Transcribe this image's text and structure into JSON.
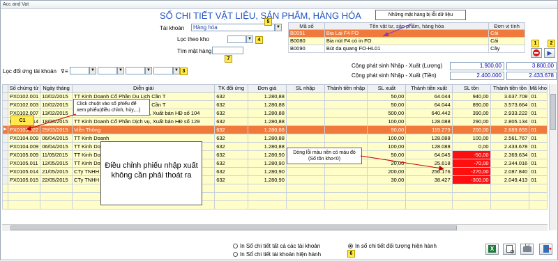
{
  "window": {
    "title": "Acc and Vat"
  },
  "heading": "SỔ CHI TIẾT VẬT LIỆU, SẢN PHẨM, HÀNG HÓA",
  "filters": {
    "account_label": "Tài khoản",
    "account_value": "Hàng hóa",
    "stock_filter_label": "Lọc theo kho",
    "item_search_label": "Tìm mặt hàng",
    "contra_filter_label": "Lọc đối ứng tài khoản",
    "contra_filter_ops": "⊽≡"
  },
  "badges": [
    "1",
    "2",
    "3",
    "4",
    "5",
    "6",
    "7"
  ],
  "callouts": {
    "error_items": "Những mặt hàng bị lỗi dữ liệu",
    "click_voucher": "Click chuột vào số phiếu để xem phiếu(điều chỉnh, hủy,...)",
    "c1": "C1",
    "red_row": "Dòng lỗi màu nền có màu đỏ (Số tồn kho<0)",
    "edit_voucher": "Điều chỉnh phiếu nhập xuất không cần phải thoát ra"
  },
  "item_grid": {
    "columns": [
      "Mã số",
      "Tên vật tư, sản phẩm, hàng hóa",
      "Đơn vị tính"
    ],
    "rows": [
      {
        "code": "B0051",
        "name": "Bia Lái F4 FO",
        "unit": "Cái",
        "state": "selected"
      },
      {
        "code": "B0080",
        "name": "Bia nút F4 có in FO",
        "unit": "Cái",
        "state": "highlight"
      },
      {
        "code": "B0090",
        "name": "Bút da quang FO-HL01",
        "unit": "Cây",
        "state": "normal"
      }
    ]
  },
  "totals": {
    "qty_label": "Cộng phát sinh Nhập - Xuất (Lượng)",
    "qty_in": "1.900,00",
    "qty_out": "3.800,00",
    "amount_label": "Cộng phát sinh Nhập - Xuất (Tiền)",
    "amount_in": "2.400.000",
    "amount_out": "2.433.678"
  },
  "ledger": {
    "columns": [
      "Số chứng từ",
      "Ngày tháng",
      "Diễn giải",
      "TK đối ứng",
      "Đơn giá",
      "SL nhập",
      "Thành tiền nhập",
      "SL xuất",
      "Thành tiền xuất",
      "SL tồn",
      "Thành tiền tồn",
      "Mã kho"
    ],
    "rows": [
      {
        "doc": "PX0102.001",
        "date": "10/02/2015",
        "desc": "TT Kinh Doanh Cổ Phần Du Lịch Cần T",
        "acct": "632",
        "price": "1.280,88",
        "qin": "",
        "ain": "",
        "qout": "50,00",
        "aout": "64.044",
        "qbal": "940,00",
        "abal": "3.637.708",
        "wh": "01",
        "state": "normal"
      },
      {
        "doc": "PX0102.003",
        "date": "10/02/2015",
        "desc": "TT Kinh Doanh Cổ Phần Du Lịch Cần T",
        "acct": "632",
        "price": "1.280,88",
        "qin": "",
        "ain": "",
        "qout": "50,00",
        "aout": "64.044",
        "qbal": "890,00",
        "abal": "3.573.664",
        "wh": "01",
        "state": "normal"
      },
      {
        "doc": "PX0102.007",
        "date": "13/02/2015",
        "desc": "TT Kinh Doanh Cổ Phần Dịch vụ, Xuất bán HĐ số 104",
        "acct": "632",
        "price": "1.280,88",
        "qin": "",
        "ain": "",
        "qout": "500,00",
        "aout": "640.442",
        "qbal": "390,00",
        "abal": "2.933.222",
        "wh": "01",
        "state": "normal"
      },
      {
        "doc": "PX0103.014",
        "date": "18/03/2015",
        "desc": "TT Kinh Doanh Cổ Phần Dịch vụ, Xuất bán HĐ số 129",
        "acct": "632",
        "price": "1.280,88",
        "qin": "",
        "ain": "",
        "qout": "100,00",
        "aout": "128.088",
        "qbal": "290,00",
        "abal": "2.805.134",
        "wh": "01",
        "state": "normal"
      },
      {
        "doc": "PX0103.022",
        "date": "29/03/2015",
        "desc": "Viễn Thông",
        "acct": "632",
        "price": "1.280,88",
        "qin": "",
        "ain": "",
        "qout": "90,00",
        "aout": "115.279",
        "qbal": "200,00",
        "abal": "2.689.855",
        "wh": "01",
        "state": "current"
      },
      {
        "doc": "PX0104.009",
        "date": "06/04/2015",
        "desc": "TT Kinh Doanh",
        "acct": "632",
        "price": "1.280,88",
        "qin": "",
        "ain": "",
        "qout": "100,00",
        "aout": "128.088",
        "qbal": "100,00",
        "abal": "2.561.767",
        "wh": "01",
        "state": "normal"
      },
      {
        "doc": "PX0104.009",
        "date": "06/04/2015",
        "desc": "TT Kinh Doanh",
        "acct": "632",
        "price": "1.280,88",
        "qin": "",
        "ain": "",
        "qout": "100,00",
        "aout": "128.088",
        "qbal": "0,00",
        "abal": "2.433.678",
        "wh": "01",
        "state": "normal"
      },
      {
        "doc": "PX0105.009",
        "date": "11/05/2015",
        "desc": "TT Kinh Doanh",
        "acct": "632",
        "price": "1.280,90",
        "qin": "",
        "ain": "",
        "qout": "50,00",
        "aout": "64.045",
        "qbal": "-50,00",
        "abal": "2.369.634",
        "wh": "01",
        "state": "negative"
      },
      {
        "doc": "PX0105.011",
        "date": "12/05/2015",
        "desc": "TT Kinh Doanh",
        "acct": "632",
        "price": "1.280,90",
        "qin": "",
        "ain": "",
        "qout": "20,00",
        "aout": "25.618",
        "qbal": "-70,00",
        "abal": "2.344.016",
        "wh": "01",
        "state": "negative"
      },
      {
        "doc": "PX0105.014",
        "date": "21/05/2015",
        "desc": "CTy TNHH Thương Mại Dịch Vụ H Vụ H",
        "acct": "632",
        "price": "1.280,90",
        "qin": "",
        "ain": "",
        "qout": "200,00",
        "aout": "256.176",
        "qbal": "-270,00",
        "abal": "2.087.840",
        "wh": "01",
        "state": "negative"
      },
      {
        "doc": "PX0105.015",
        "date": "22/05/2015",
        "desc": "CTy TNHH",
        "acct": "632",
        "price": "1.280,90",
        "qin": "",
        "ain": "",
        "qout": "30,00",
        "aout": "38.427",
        "qbal": "-300,00",
        "abal": "2.049.413",
        "wh": "01",
        "state": "negative"
      }
    ]
  },
  "options": {
    "all_accounts": "In Sổ chi tiết tất cả các tài khoản",
    "current_account": "In Sổ chi tiết tài khoản hiện hành",
    "current_object": "In sổ chi tiết đối tượng hiện hành"
  },
  "icons": {
    "stop": "stop-icon",
    "next": "arrow-right-icon",
    "excel": "excel-icon",
    "preview": "preview-icon",
    "print": "printer-icon",
    "exit": "exit-icon"
  },
  "colors": {
    "heading": "#1f52c4",
    "selected_row": "#f07a3c",
    "negative_cell": "#ff1010",
    "row_fill": "#fffec8",
    "badge": "#ffe94d"
  }
}
